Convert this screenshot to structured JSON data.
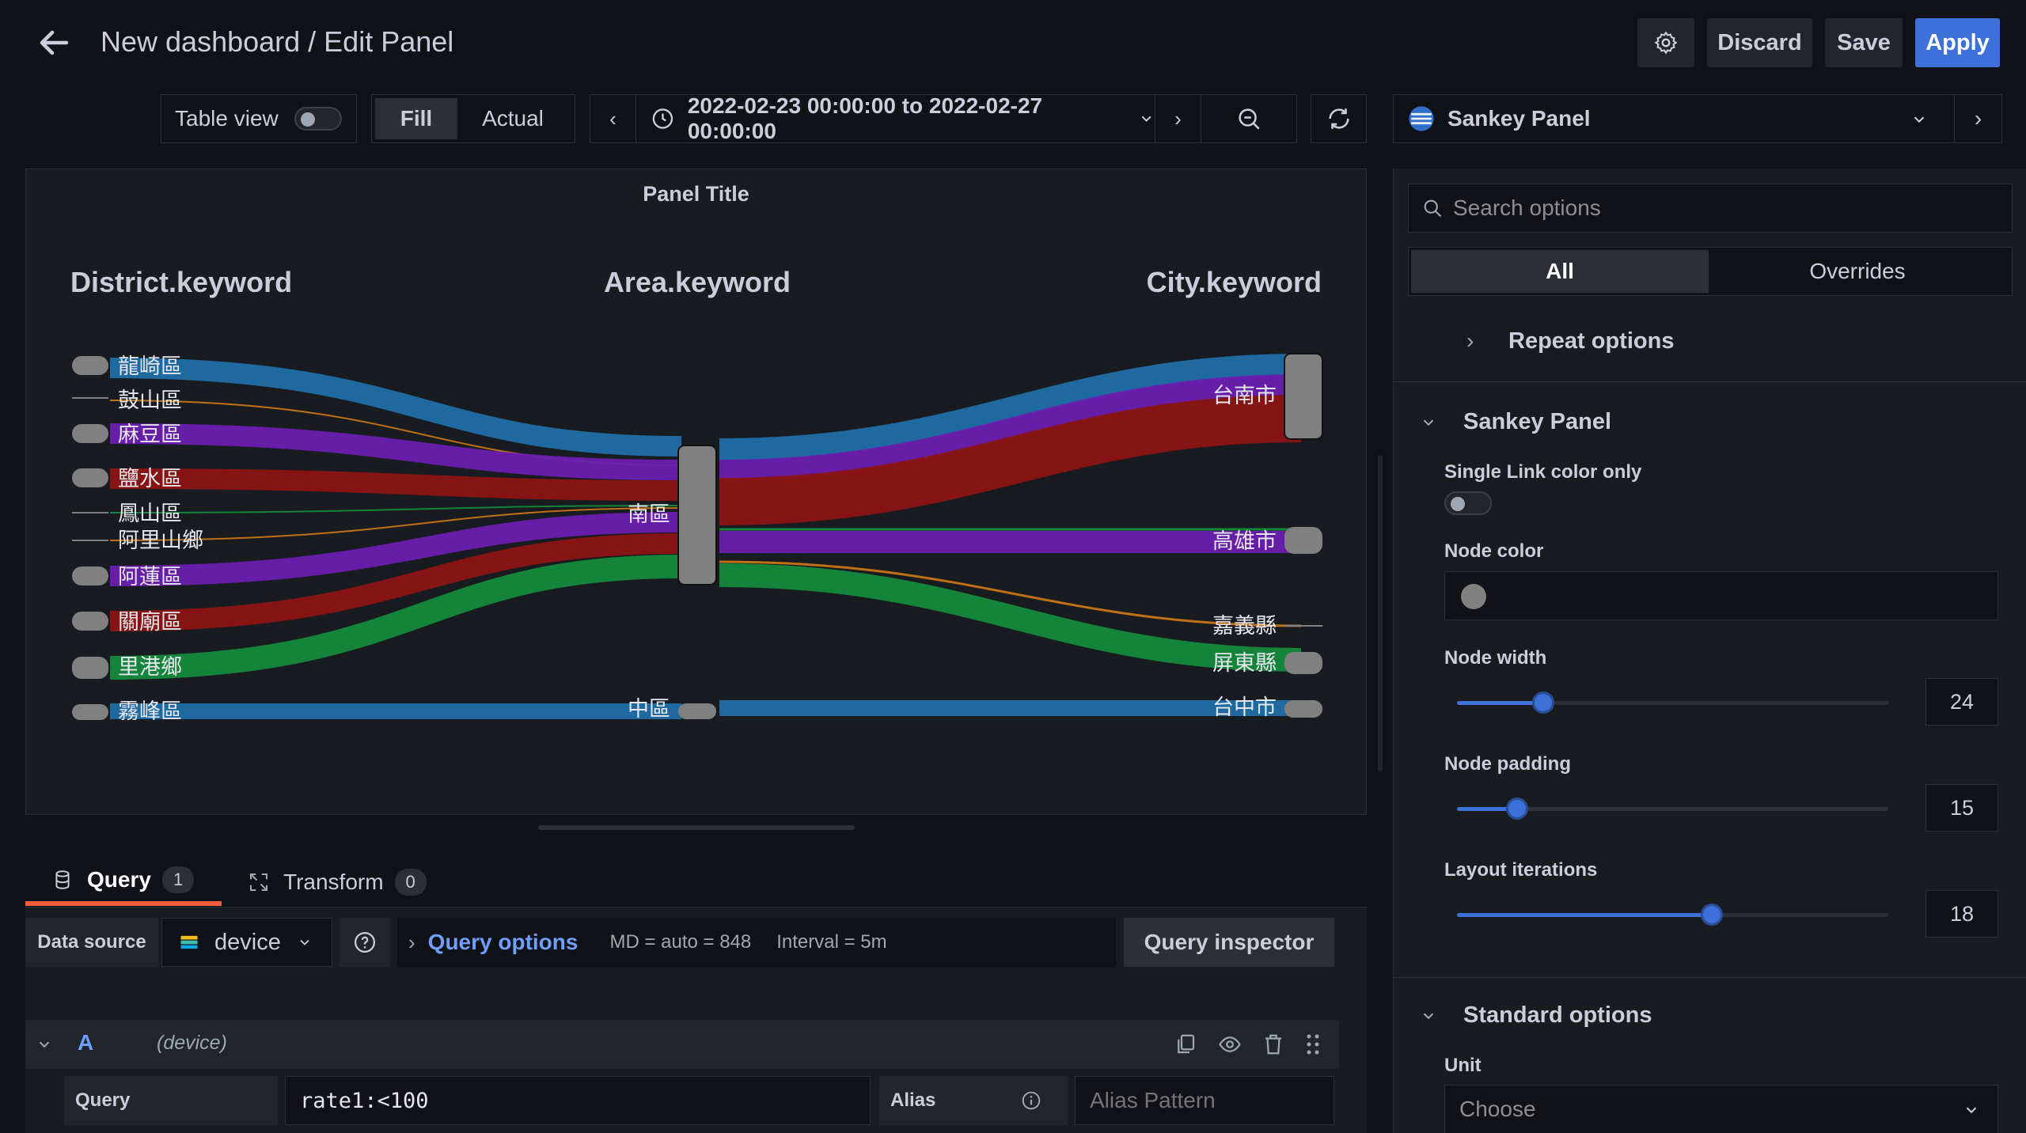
{
  "header": {
    "title": "New dashboard / Edit Panel",
    "discard_label": "Discard",
    "save_label": "Save",
    "apply_label": "Apply"
  },
  "toolbar": {
    "table_view_label": "Table view",
    "fill_label": "Fill",
    "actual_label": "Actual",
    "time_range": "2022-02-23 00:00:00 to 2022-02-27 00:00:00",
    "visualization": "Sankey Panel"
  },
  "panel": {
    "title": "Panel Title",
    "columns": [
      "District.keyword",
      "Area.keyword",
      "City.keyword"
    ],
    "district_nodes": [
      "龍崎區",
      "鼓山區",
      "麻豆區",
      "鹽水區",
      "鳳山區",
      "阿里山鄉",
      "阿蓮區",
      "關廟區",
      "里港鄉",
      "霧峰區"
    ],
    "area_nodes": [
      "南區",
      "中區"
    ],
    "city_nodes": [
      "台南市",
      "高雄市",
      "嘉義縣",
      "屏東縣",
      "台中市"
    ],
    "colors": {
      "blue": "#1f6fa8",
      "purple": "#6a1fb0",
      "red": "#8c1414",
      "green": "#148a3c",
      "orange": "#c87514",
      "node": "#808080"
    }
  },
  "query_tabs": {
    "query_label": "Query",
    "query_count": "1",
    "transform_label": "Transform",
    "transform_count": "0"
  },
  "query_bar": {
    "data_source_label": "Data source",
    "data_source_value": "device",
    "query_options_label": "Query options",
    "md_text": "MD = auto = 848",
    "interval_text": "Interval = 5m",
    "inspector_label": "Query inspector"
  },
  "query_row": {
    "ref_id": "A",
    "datasource_note": "(device)",
    "query_label": "Query",
    "query_value": "rate1:<100",
    "alias_label": "Alias",
    "alias_placeholder": "Alias Pattern"
  },
  "options": {
    "search_placeholder": "Search options",
    "tab_all": "All",
    "tab_overrides": "Overrides",
    "repeat_options": "Repeat options",
    "sankey_section": "Sankey Panel",
    "single_link_label": "Single Link color only",
    "node_color_label": "Node color",
    "node_width_label": "Node width",
    "node_width_value": "24",
    "node_width_fraction": 0.2,
    "node_padding_label": "Node padding",
    "node_padding_value": "15",
    "node_padding_fraction": 0.14,
    "layout_iterations_label": "Layout iterations",
    "layout_iterations_value": "18",
    "layout_iterations_fraction": 0.59,
    "standard_section": "Standard options",
    "unit_label": "Unit",
    "unit_placeholder": "Choose"
  }
}
